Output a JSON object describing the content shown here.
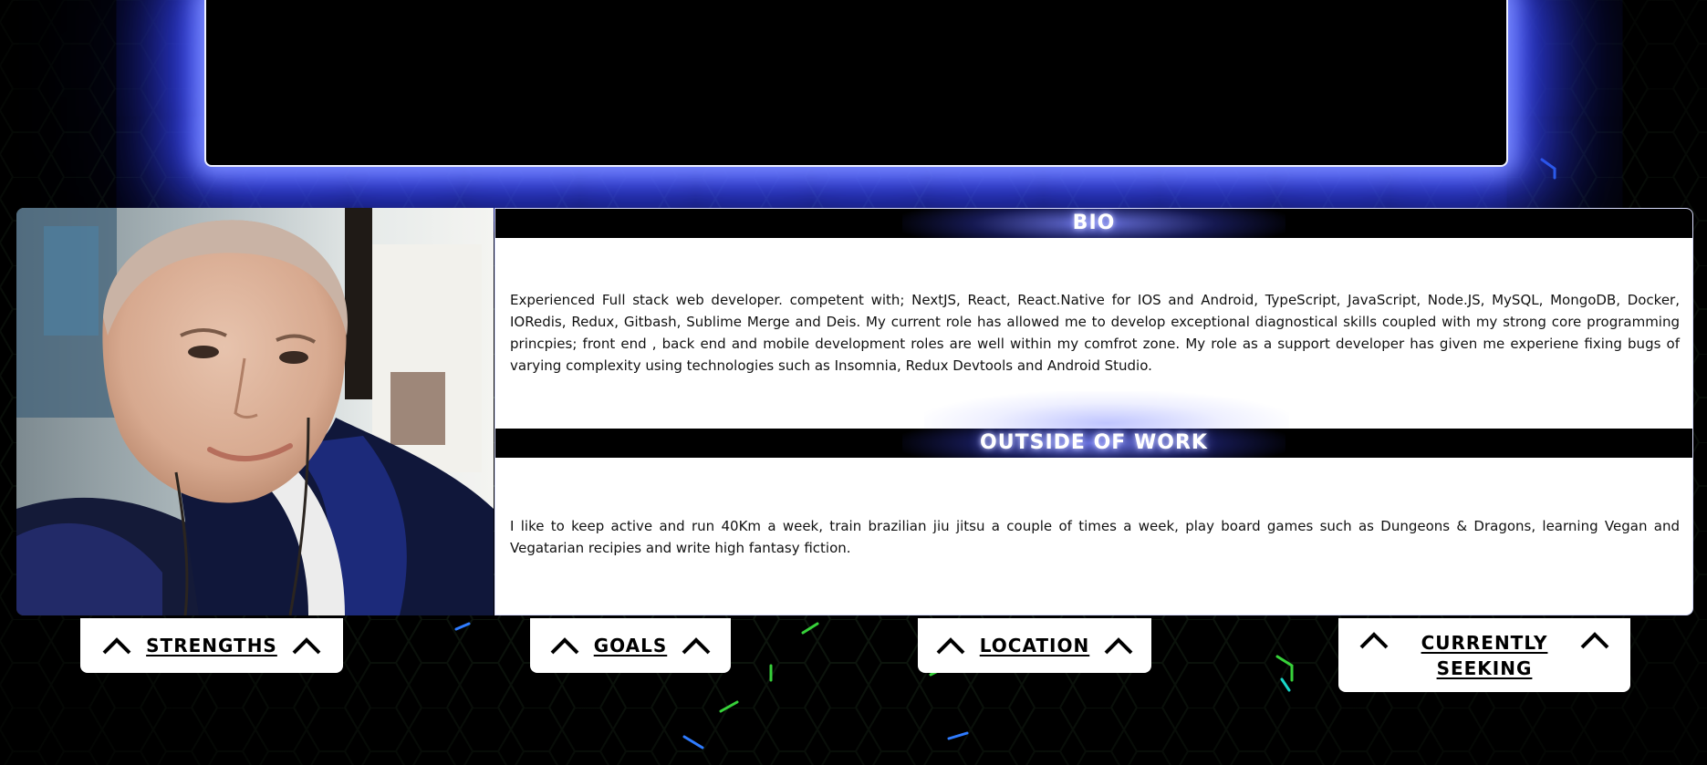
{
  "theme": {
    "background": "#000000",
    "glow_color": "#4a5cff",
    "panel_color": "#ffffff",
    "text_color": "#111111",
    "circuit_colors": [
      "#2f7cff",
      "#37d13a",
      "#ffd21f",
      "#19d6c8",
      "#ff2a1f"
    ]
  },
  "profile": {
    "photo_alt": "profile-photo"
  },
  "bio": {
    "heading": "BIO",
    "text": "Experienced Full stack web developer. competent with; NextJS, React, React.Native for IOS and Android, TypeScript, JavaScript, Node.JS, MySQL, MongoDB, Docker, IORedis, Redux, Gitbash, Sublime Merge and Deis. My current role has allowed me to develop exceptional diagnostical skills coupled with my strong core programming princpies; front end , back end and mobile development roles are well within my comfrot zone. My role as a support developer has given me experiene fixing bugs of varying complexity using technologies such as Insomnia, Redux Devtools and Android Studio."
  },
  "outside_work": {
    "heading": "OUTSIDE OF WORK",
    "text": "I like to keep active and run 40Km a week, train brazilian jiu jitsu a couple of times a week, play board games such as Dungeons & Dragons, learning Vegan and Vegatarian recipies and write high fantasy fiction."
  },
  "tabs": [
    {
      "label": "STRENGTHS",
      "icon": "chevron-up-icon"
    },
    {
      "label": "GOALS",
      "icon": "chevron-up-icon"
    },
    {
      "label": "LOCATION",
      "icon": "chevron-up-icon"
    },
    {
      "label": "CURRENTLY SEEKING",
      "icon": "chevron-up-icon"
    }
  ]
}
